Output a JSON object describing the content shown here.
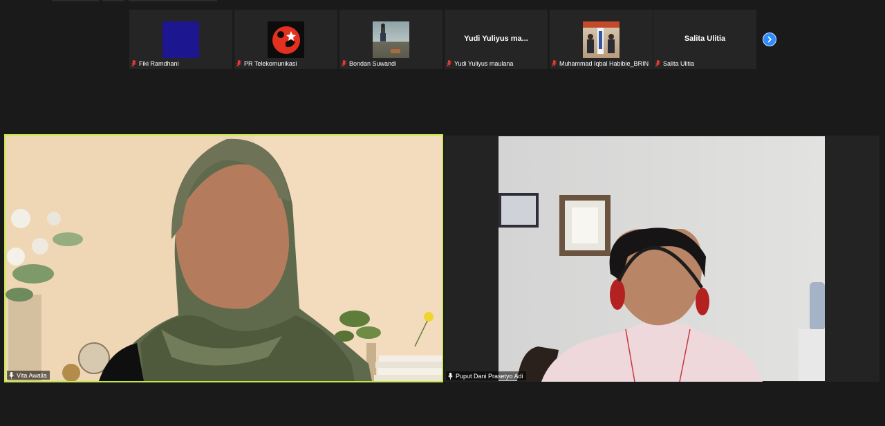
{
  "gallery_strip": {
    "participants": [
      {
        "name": "Fiki Ramdhani",
        "avatar": "solid-blue-avatar",
        "muted": true
      },
      {
        "name": "PR Telekomunikasi",
        "avatar": "logo-avatar",
        "muted": true
      },
      {
        "name": "Bondan Suwandi",
        "avatar": "photo-avatar",
        "muted": true
      },
      {
        "name": "Yudi Yuliyus maulana",
        "display": "Yudi Yuliyus ma...",
        "muted": true
      },
      {
        "name": "Muhammad Iqbal Habibie_BRIN",
        "avatar": "photo-avatar",
        "muted": true
      },
      {
        "name": "Salita Ulitia",
        "display": "Salita Ulitia",
        "muted": true
      }
    ],
    "next_icon": "chevron-right-icon"
  },
  "main_video": {
    "tiles": [
      {
        "name": "Vita Awalia",
        "active_speaker": true,
        "mic": "mic-on"
      },
      {
        "name": "Puput Dani Prasetyo Adi",
        "active_speaker": false,
        "mic": "mic-on"
      }
    ]
  },
  "colors": {
    "background": "#1a1a1a",
    "thumb_bg": "#252525",
    "active_speaker_border": "#c4e84a",
    "muted_mic": "#e53935",
    "next_button": "#2d8cff"
  }
}
